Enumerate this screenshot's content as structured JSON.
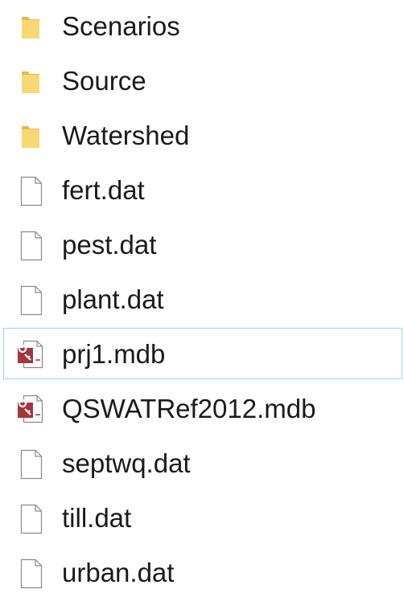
{
  "explorer": {
    "items": [
      {
        "name": "Scenarios",
        "icon": "folder-icon"
      },
      {
        "name": "Source",
        "icon": "folder-icon"
      },
      {
        "name": "Watershed",
        "icon": "folder-icon"
      },
      {
        "name": "fert.dat",
        "icon": "file-icon"
      },
      {
        "name": "pest.dat",
        "icon": "file-icon"
      },
      {
        "name": "plant.dat",
        "icon": "file-icon"
      },
      {
        "name": "prj1.mdb",
        "icon": "access-database-icon",
        "hovered": true
      },
      {
        "name": "QSWATRef2012.mdb",
        "icon": "access-database-icon"
      },
      {
        "name": "septwq.dat",
        "icon": "file-icon"
      },
      {
        "name": "till.dat",
        "icon": "file-icon"
      },
      {
        "name": "urban.dat",
        "icon": "file-icon"
      }
    ]
  },
  "colors": {
    "folder": "#f8d775",
    "hover_border": "#99d1ff",
    "access_red": "#a4373a"
  }
}
